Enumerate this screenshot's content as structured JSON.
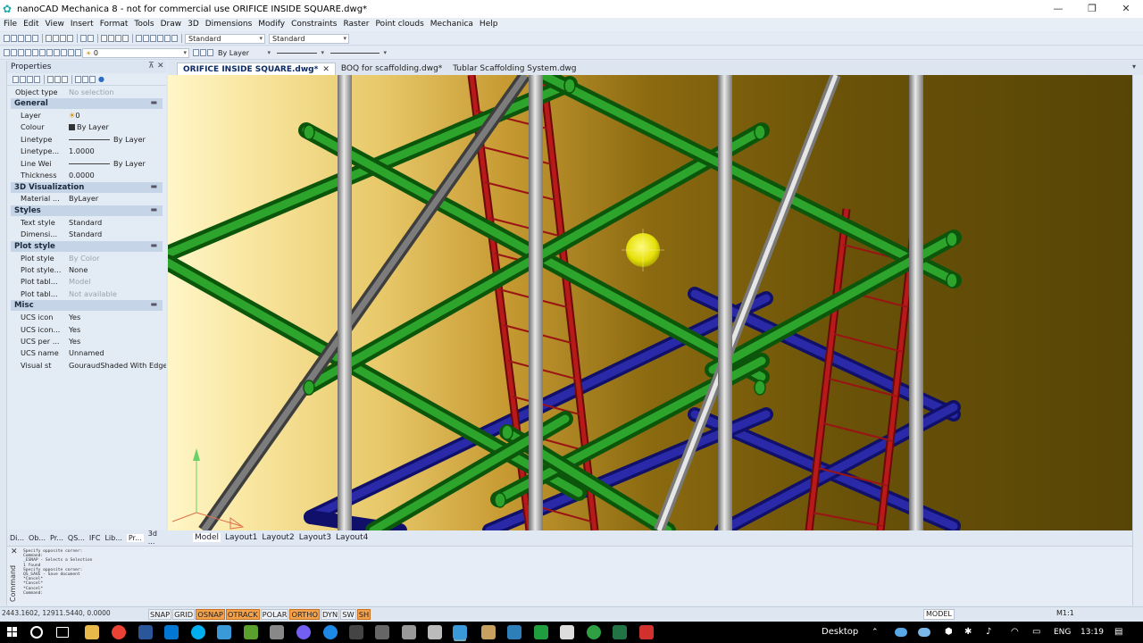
{
  "window": {
    "title": "nanoCAD Mechanica 8 - not for commercial use ORIFICE INSIDE SQUARE.dwg*",
    "controls": {
      "minimize": "—",
      "maximize": "❐",
      "close": "✕"
    }
  },
  "menu": [
    "File",
    "Edit",
    "View",
    "Insert",
    "Format",
    "Tools",
    "Draw",
    "3D",
    "Dimensions",
    "Modify",
    "Constraints",
    "Raster",
    "Point clouds",
    "Mechanica",
    "Help"
  ],
  "toolbar": {
    "text_style": "Standard",
    "dim_style": "Standard",
    "layer_value": "0",
    "color_value": "By Layer"
  },
  "properties": {
    "title": "Properties",
    "pin": "⊼",
    "close": "✕",
    "object_type_label": "Object type",
    "object_type_value": "No selection",
    "sections": {
      "general": "General",
      "visual": "3D Visualization",
      "styles": "Styles",
      "plot": "Plot style",
      "misc": "Misc"
    },
    "rows": {
      "layer": {
        "k": "Layer",
        "v": "0"
      },
      "colour": {
        "k": "Colour",
        "v": "By Layer"
      },
      "linetype": {
        "k": "Linetype",
        "v": "By Layer"
      },
      "linetype_scale": {
        "k": "Linetype...",
        "v": "1.0000"
      },
      "line_weight": {
        "k": "Line Wei",
        "v": "By Layer"
      },
      "thickness": {
        "k": "Thickness",
        "v": "0.0000"
      },
      "material": {
        "k": "Material ...",
        "v": "ByLayer"
      },
      "text_style": {
        "k": "Text style",
        "v": "Standard"
      },
      "dim_style": {
        "k": "Dimensi...",
        "v": "Standard"
      },
      "plot_style": {
        "k": "Plot style",
        "v": "By Color"
      },
      "plot_style_table": {
        "k": "Plot style...",
        "v": "None"
      },
      "plot_table1": {
        "k": "Plot tabl...",
        "v": "Model"
      },
      "plot_table2": {
        "k": "Plot tabl...",
        "v": "Not available"
      },
      "ucs_icon": {
        "k": "UCS icon",
        "v": "Yes"
      },
      "ucs_icon2": {
        "k": "UCS icon...",
        "v": "Yes"
      },
      "ucs_per": {
        "k": "UCS per ...",
        "v": "Yes"
      },
      "ucs_name": {
        "k": "UCS name",
        "v": "Unnamed"
      },
      "visual_style": {
        "k": "Visual st",
        "v": "GouraudShaded With Edges"
      }
    },
    "tabs": [
      "Di...",
      "Ob...",
      "Pr...",
      "QS...",
      "IFC",
      "Lib...",
      "Pr...",
      "3d ..."
    ]
  },
  "doc_tabs": [
    {
      "label": "ORIFICE INSIDE SQUARE.dwg*",
      "close": "✕"
    },
    {
      "label": "BOQ for scaffolding.dwg*"
    },
    {
      "label": "Tublar Scaffolding System.dwg"
    }
  ],
  "layout_tabs": [
    "Model",
    "Layout1",
    "Layout2",
    "Layout3",
    "Layout4"
  ],
  "command": {
    "label": "Command",
    "close": "✕",
    "history": [
      "Specify opposite corner:",
      "Command:",
      "_ESNAP - Selects a Selection",
      "1 found",
      "Specify opposite corner:",
      "QS_SAVE - Save document",
      "*Cancel*",
      "*Cancel*",
      "*Cancel*",
      "Command:"
    ]
  },
  "status": {
    "coords": "2443.1602, 12911.5440, 0.0000",
    "toggles": [
      {
        "label": "SNAP",
        "on": false
      },
      {
        "label": "GRID",
        "on": false
      },
      {
        "label": "OSNAP",
        "on": true
      },
      {
        "label": "OTRACK",
        "on": true
      },
      {
        "label": "POLAR",
        "on": false
      },
      {
        "label": "ORTHO",
        "on": true
      },
      {
        "label": "DYN",
        "on": false
      },
      {
        "label": "SW",
        "on": false
      },
      {
        "label": "SH",
        "on": true
      }
    ],
    "model": "MODEL",
    "scale": "M1:1"
  },
  "taskbar": {
    "desktop": "Desktop",
    "lang": "ENG",
    "time": "13:19"
  },
  "colors": {
    "scaffold_green": "#1f8a1f",
    "scaffold_blue": "#1a1a8c",
    "scaffold_red": "#a01616",
    "scaffold_silver": "#b8b8b8",
    "light_yellow": "#e6e00a",
    "osnap_orange": "#f5a14a"
  }
}
